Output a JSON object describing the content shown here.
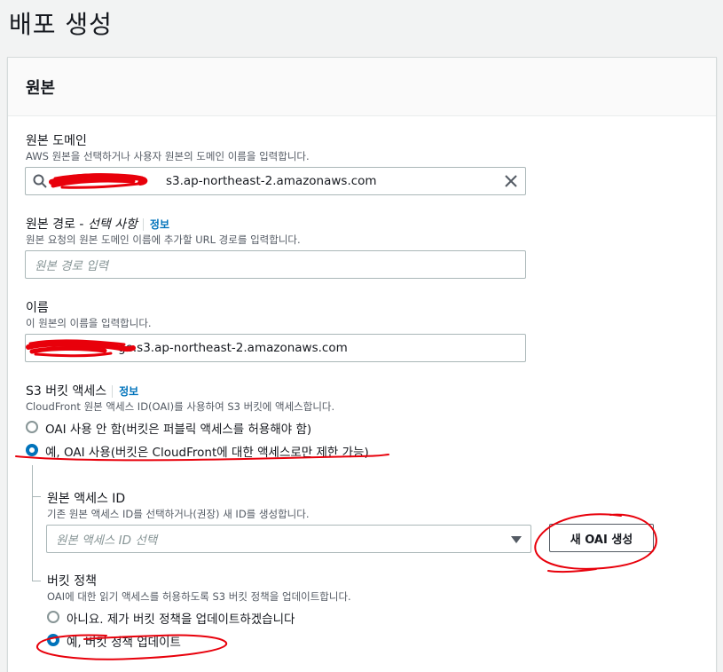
{
  "page": {
    "title": "배포 생성"
  },
  "panel": {
    "title": "원본"
  },
  "origin_domain": {
    "label": "원본 도메인",
    "desc": "AWS 원본을 선택하거나 사용자 원본의 도메인 이름을 입력합니다.",
    "value": "s3.ap-northeast-2.amazonaws.com"
  },
  "origin_path": {
    "label": "원본 경로 - ",
    "optional": "선택 사항",
    "info": "정보",
    "desc": "원본 요청의 원본 도메인 이름에 추가할 URL 경로를 입력합니다.",
    "placeholder": "원본 경로 입력"
  },
  "name": {
    "label": "이름",
    "desc": "이 원본의 이름을 입력합니다.",
    "value": "ge.s3.ap-northeast-2.amazonaws.com"
  },
  "s3_access": {
    "label": "S3 버킷 액세스",
    "info": "정보",
    "desc": "CloudFront 원본 액세스 ID(OAI)를 사용하여 S3 버킷에 액세스합니다.",
    "options": [
      {
        "label": "OAI 사용 안 함(버킷은 퍼블릭 액세스를 허용해야 함)",
        "checked": false
      },
      {
        "label": "예, OAI 사용(버킷은 CloudFront에 대한 액세스로만 제한 가능)",
        "checked": true
      }
    ]
  },
  "oai": {
    "label": "원본 액세스 ID",
    "desc": "기존 원본 액세스 ID를 선택하거나(권장) 새 ID를 생성합니다.",
    "placeholder": "원본 액세스 ID 선택",
    "create_button": "새 OAI 생성"
  },
  "bucket_policy": {
    "label": "버킷 정책",
    "desc": "OAI에 대한 읽기 액세스를 허용하도록 S3 버킷 정책을 업데이트합니다.",
    "options": [
      {
        "label": "아니요. 제가 버킷 정책을 업데이트하겠습니다",
        "checked": false
      },
      {
        "label": "예, 버킷 정책 업데이트",
        "checked": true
      }
    ]
  },
  "colors": {
    "accent": "#0073bb",
    "annotation": "#e8000b"
  }
}
